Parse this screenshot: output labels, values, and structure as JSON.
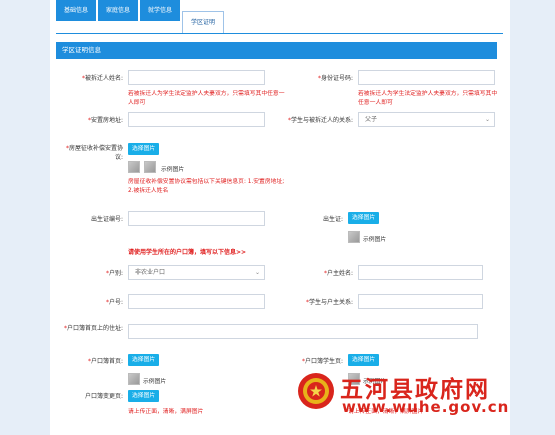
{
  "tabs": [
    {
      "label": "基础信息"
    },
    {
      "label": "家庭信息"
    },
    {
      "label": "就学信息"
    },
    {
      "label": "学区证明"
    }
  ],
  "section_title": "学区证明信息",
  "fields": {
    "owner_name": {
      "label": "被拆迁人姓名:"
    },
    "id_number": {
      "label": "身份证号码:"
    },
    "owner_hint": "若被拆迁人为学生法定监护人夫妻双方，只需填写其中任意一人即可",
    "id_hint": "若被拆迁人为学生法定监护人夫妻双方，只需填写其中任意一人即可",
    "address": {
      "label": "安置房地址:"
    },
    "relation": {
      "label": "学生与被拆迁人的关系:",
      "value": "父子"
    },
    "agreement": {
      "label": "房屋征收补偿安置协议:",
      "button": "选择图片",
      "sample": "示例图片",
      "hint": "房屋征收补偿安置协议需包括以下关键信息页: 1.安置房地址; 2.被拆迁人姓名"
    },
    "birth_no": {
      "label": "出生证编号:"
    },
    "birth_cert": {
      "label": "出生证:",
      "button": "选择图片",
      "sample": "示例图片"
    },
    "notice": "请使用学生所在的户口簿，填写以下信息>>",
    "hukou_type": {
      "label": "户别:",
      "value": "非农业户口"
    },
    "householder": {
      "label": "户主姓名:"
    },
    "hukou_no": {
      "label": "户号:"
    },
    "relation_head": {
      "label": "学生与户主关系:"
    },
    "hukou_address": {
      "label": "户口簿首页上的住址:"
    },
    "hukou_first": {
      "label": "户口簿首页:",
      "button": "选择图片",
      "sample": "示例图片"
    },
    "hukou_student": {
      "label": "户口簿学生页:",
      "button": "选择图片",
      "sample": "示例图片"
    },
    "hukou_change": {
      "label": "户口簿变更页:",
      "button": "选择图片"
    },
    "upload_hint1": "请上传正面，清晰，满屏图片",
    "upload_hint2": "请上传正面，清晰，满屏图片"
  },
  "watermark": {
    "title": "五河县政府网",
    "url": "www.wuhe.gov.cn"
  }
}
